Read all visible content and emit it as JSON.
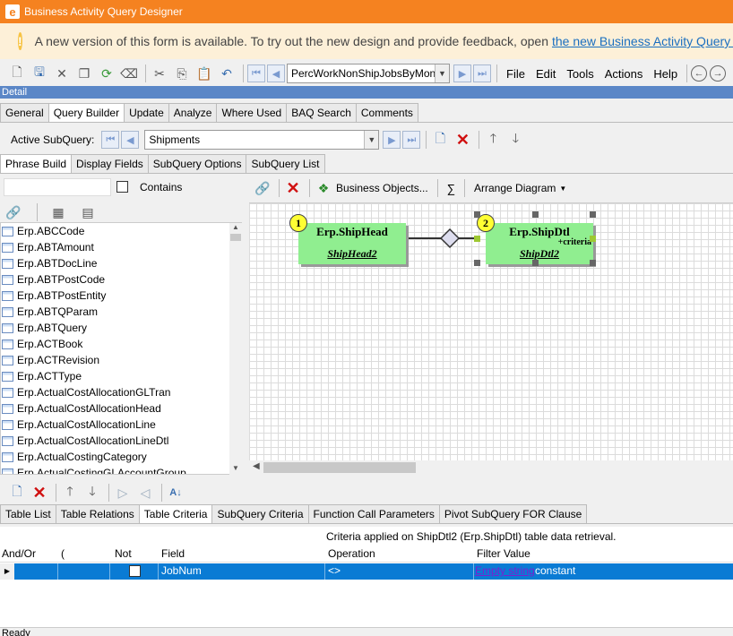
{
  "window": {
    "title": "Business Activity Query Designer"
  },
  "banner": {
    "text": "A new version of this form is available. To try out the new design and provide feedback, open",
    "link": "the new Business Activity Query app"
  },
  "toolbar": {
    "query_name": "PercWorkNonShipJobsByMon",
    "menus": [
      "File",
      "Edit",
      "Tools",
      "Actions",
      "Help"
    ]
  },
  "detail_label": "Detail",
  "main_tabs": [
    "General",
    "Query Builder",
    "Update",
    "Analyze",
    "Where Used",
    "BAQ Search",
    "Comments"
  ],
  "main_tabs_active": "Query Builder",
  "subquery": {
    "label": "Active SubQuery:",
    "value": "Shipments"
  },
  "sub_tabs": [
    "Phrase Build",
    "Display Fields",
    "SubQuery Options",
    "SubQuery List"
  ],
  "sub_tabs_active": "Phrase Build",
  "search": {
    "value": "",
    "contains_label": "Contains",
    "contains_checked": false
  },
  "table_list": [
    "Erp.ABCCode",
    "Erp.ABTAmount",
    "Erp.ABTDocLine",
    "Erp.ABTPostCode",
    "Erp.ABTPostEntity",
    "Erp.ABTQParam",
    "Erp.ABTQuery",
    "Erp.ACTBook",
    "Erp.ACTRevision",
    "Erp.ACTType",
    "Erp.ActualCostAllocationGLTran",
    "Erp.ActualCostAllocationHead",
    "Erp.ActualCostAllocationLine",
    "Erp.ActualCostAllocationLineDtl",
    "Erp.ActualCostingCategory",
    "Erp.ActualCostingGLAccountGroup"
  ],
  "diagram_toolbar": {
    "business_objects": "Business Objects...",
    "sigma": "∑",
    "arrange": "Arrange Diagram"
  },
  "diagram": {
    "tables": [
      {
        "number": "1",
        "name": "Erp.ShipHead",
        "alias": "ShipHead2",
        "extra": ""
      },
      {
        "number": "2",
        "name": "Erp.ShipDtl",
        "alias": "ShipDtl2",
        "extra": "+criteria"
      }
    ]
  },
  "bottom_tabs": [
    "Table List",
    "Table Relations",
    "Table Criteria",
    "SubQuery Criteria",
    "Function Call Parameters",
    "Pivot SubQuery FOR Clause"
  ],
  "bottom_tabs_active": "Table Criteria",
  "criteria_caption": "Criteria applied on ShipDtl2 (Erp.ShipDtl)  table data retrieval.",
  "grid": {
    "headers": [
      "And/Or",
      "(",
      "Not",
      "Field",
      "Operation",
      "Filter Value"
    ],
    "rows": [
      {
        "andor": "",
        "paren": "",
        "not": false,
        "field": "JobNum",
        "operation": "<>",
        "filter_link": "Empty string",
        "filter_type": "constant"
      }
    ]
  },
  "status": {
    "text": "Ready"
  },
  "colors": {
    "titlebar": "#f58220",
    "banner": "#fdf0d8",
    "table_box": "#90ee90",
    "selection": "#0a7bd4"
  }
}
